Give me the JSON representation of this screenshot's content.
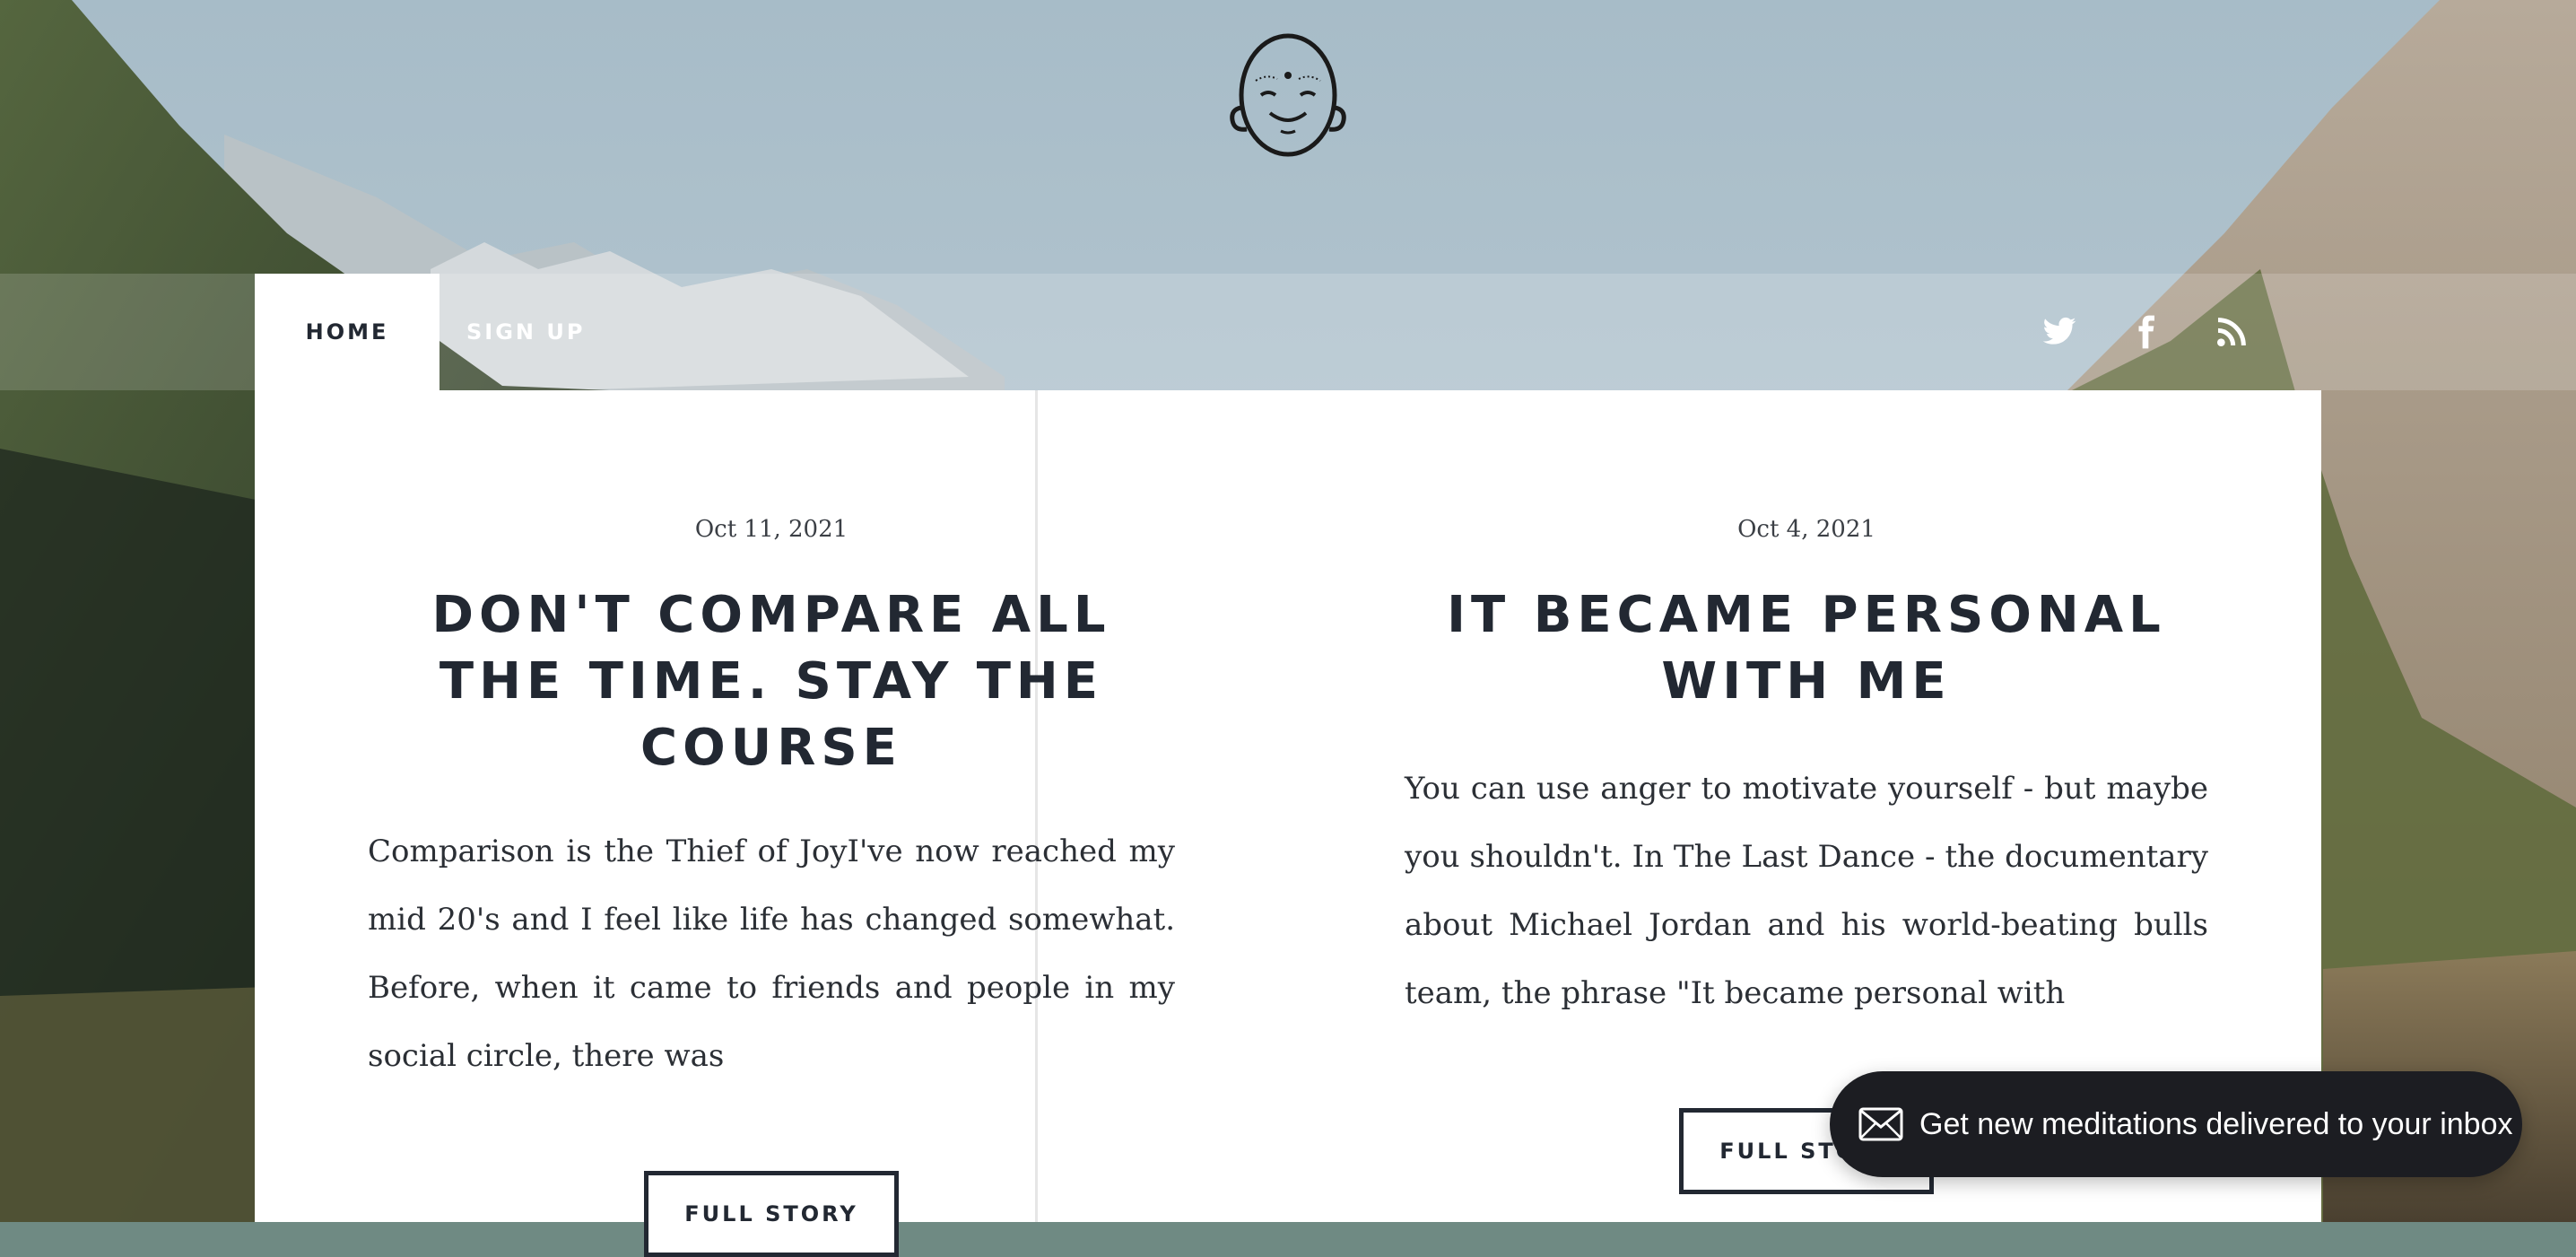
{
  "header": {
    "logo_icon": "smiling-buddha-face-icon"
  },
  "nav": {
    "tabs": [
      {
        "label": "Home",
        "active": true
      },
      {
        "label": "Sign up",
        "active": false
      }
    ],
    "social_icons": [
      "twitter-icon",
      "facebook-icon",
      "rss-icon"
    ]
  },
  "posts": [
    {
      "date": "Oct 11, 2021",
      "title": "Don't compare all the time. Stay the course",
      "excerpt": "Comparison is the Thief of JoyI've now reached my mid 20's and I feel like life has changed somewhat. Before, when it came to friends and people in my social circle, there was",
      "button_label": "Full story"
    },
    {
      "date": "Oct 4, 2021",
      "title": "It became personal with me",
      "excerpt": "You can use anger to motivate yourself - but maybe you shouldn't. In The Last Dance - the documentary about Michael Jordan and his world-beating bulls team, the phrase \"It became personal with",
      "button_label": "Full story"
    }
  ],
  "subscribe": {
    "icon": "envelope-icon",
    "text": "Get new meditations delivered to your inbox"
  },
  "colors": {
    "text_dark": "#222832",
    "pill_bg": "#1c1d22",
    "panel_bg": "#ffffff"
  }
}
